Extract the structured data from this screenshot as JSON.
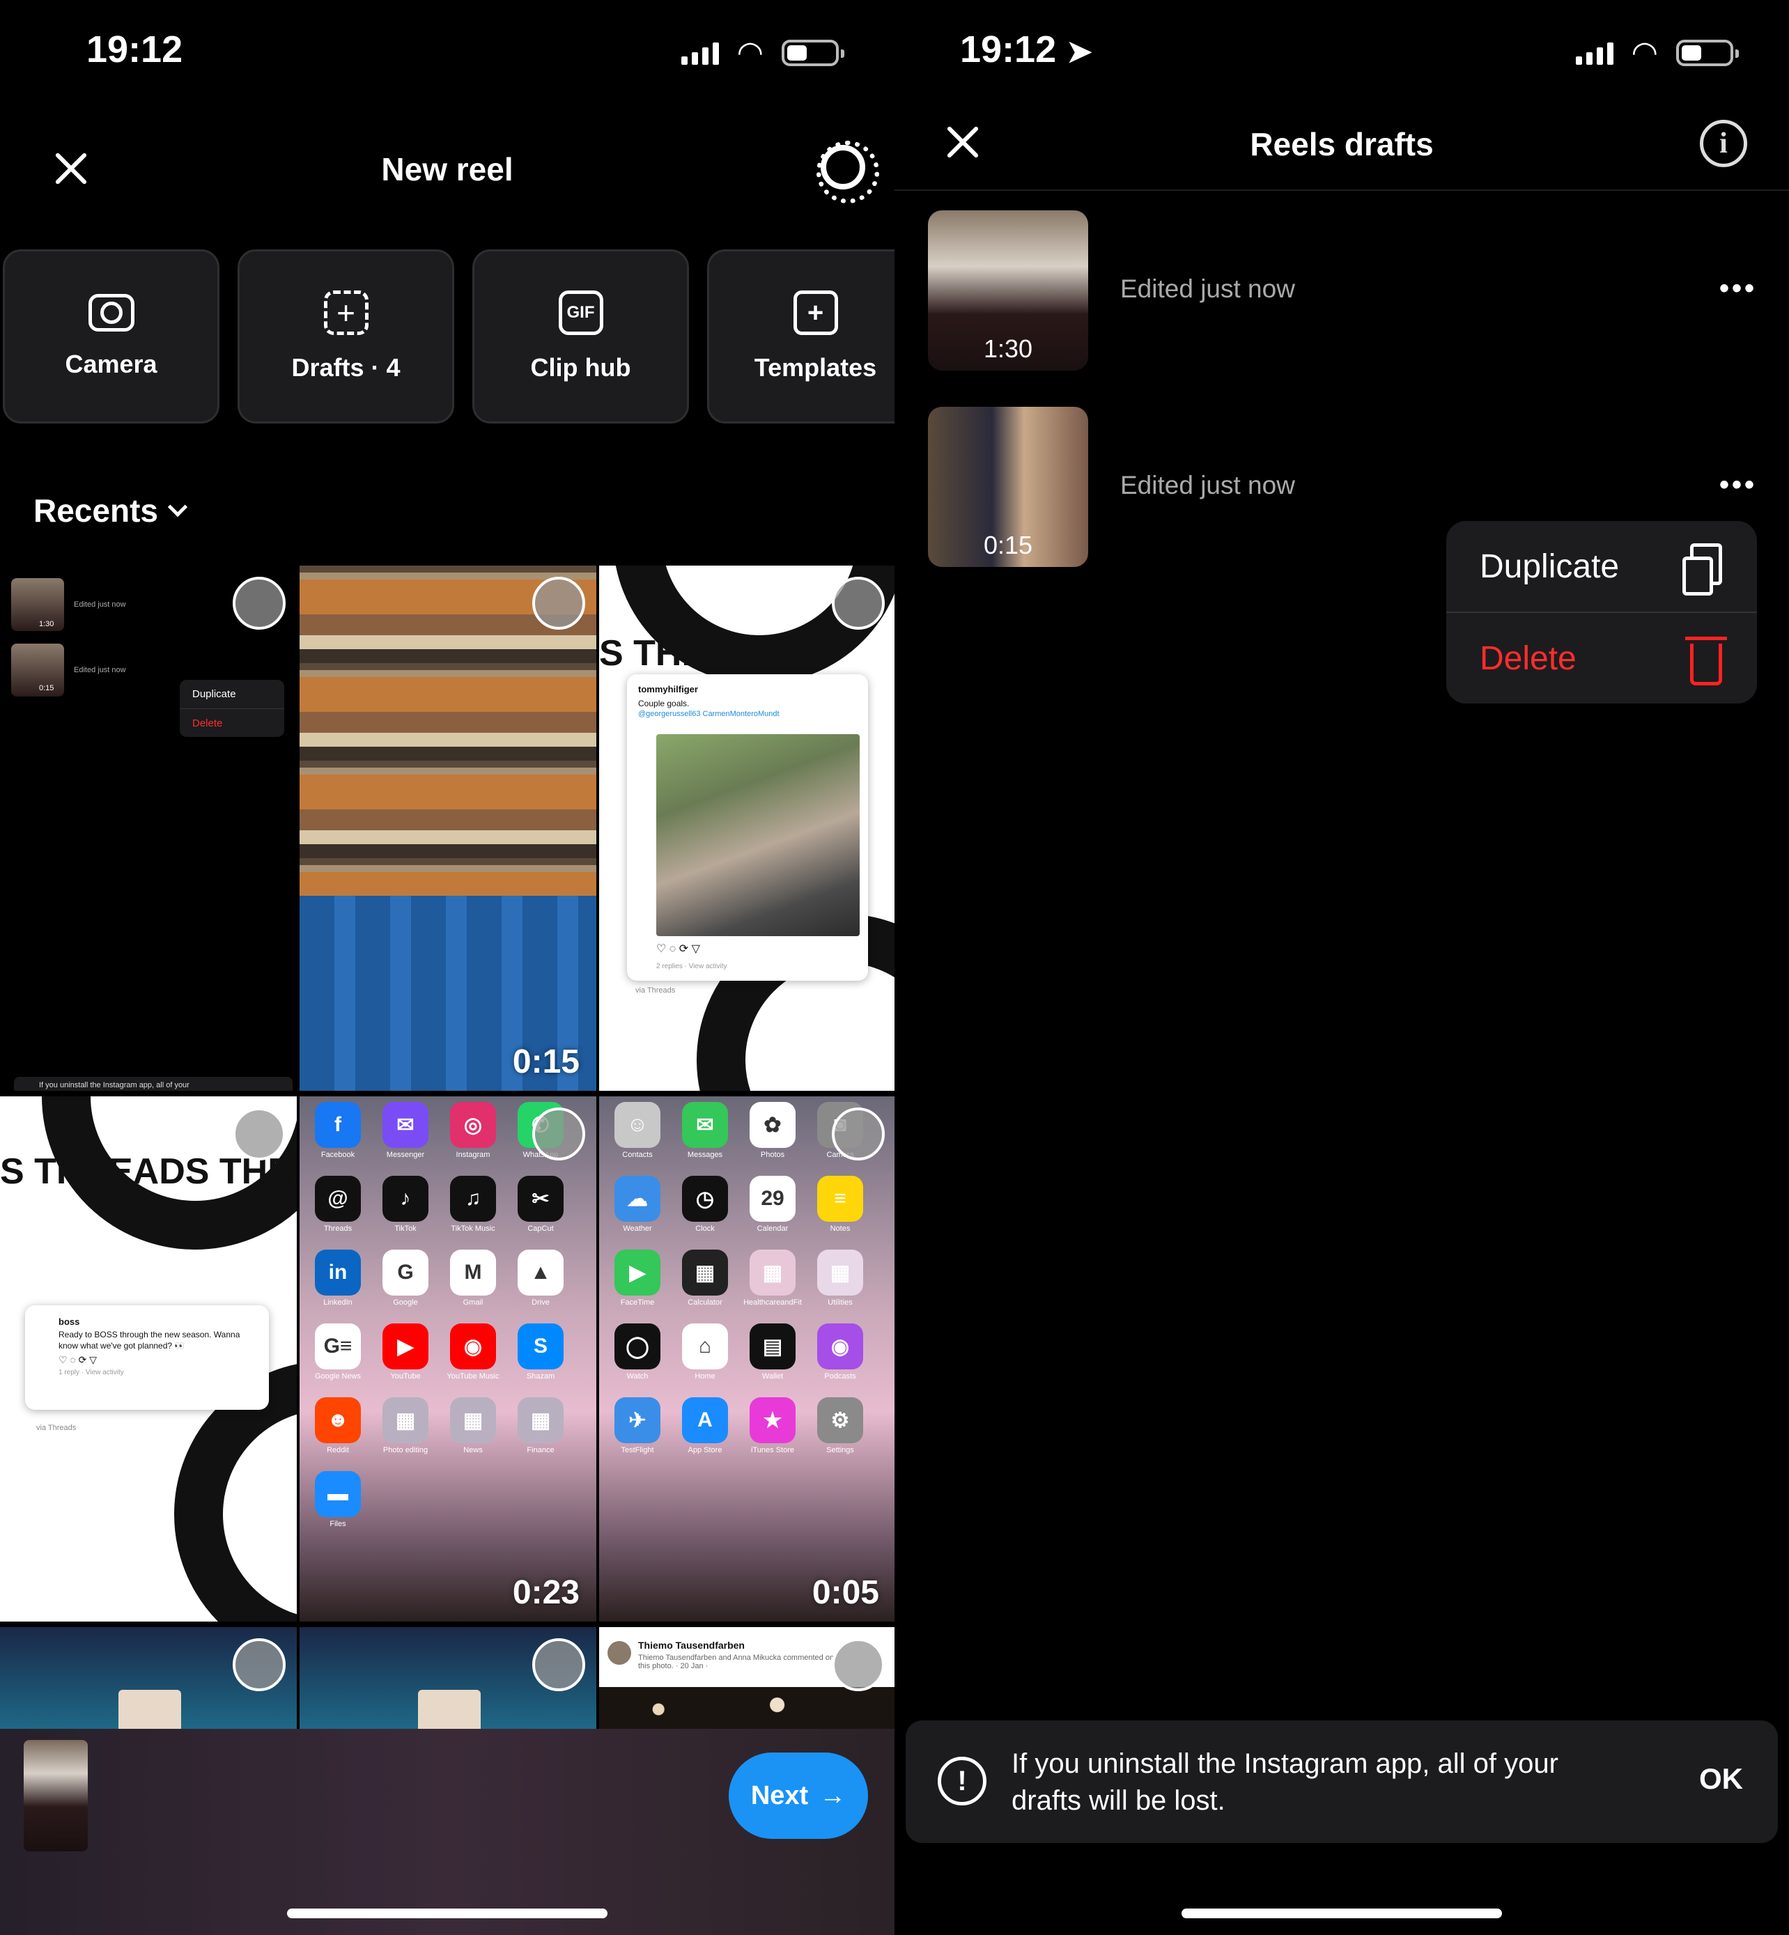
{
  "left": {
    "status": {
      "time": "19:12"
    },
    "header": {
      "title": "New reel"
    },
    "tiles": [
      {
        "label": "Camera",
        "icon": "camera-icon"
      },
      {
        "label": "Drafts · 4",
        "icon": "add-dashed-icon"
      },
      {
        "label": "Clip hub",
        "icon": "gif-icon"
      },
      {
        "label": "Templates",
        "icon": "template-add-icon"
      }
    ],
    "recents": {
      "label": "Recents"
    },
    "gallery": [
      {
        "kind": "drafts-screenshot",
        "rows": [
          {
            "duration": "1:30",
            "text": "Edited just now"
          },
          {
            "duration": "0:15",
            "text": "Edited just now"
          }
        ],
        "menu": [
          "Duplicate",
          "Delete"
        ],
        "toast_fragment": "If you uninstall the Instagram app, all of your"
      },
      {
        "kind": "video",
        "duration": "0:15"
      },
      {
        "kind": "threads-post",
        "band_text": "S THREADS",
        "handle": "tommyhilfiger",
        "body": "Couple goals.",
        "link": "@georgerussell63 CarmenMonteroMundt",
        "meta": "2 replies · View activity",
        "via": "via Threads"
      },
      {
        "kind": "threads-post",
        "band_text": "S THREADS THREADS",
        "handle": "boss",
        "body": "Ready to BOSS through the new season. Wanna know what we've got planned? 👀",
        "meta": "1 reply · View activity",
        "via": "via Threads"
      },
      {
        "kind": "homescreen",
        "duration": "0:23",
        "apps": [
          {
            "label": "Facebook",
            "glyph": "f",
            "color": "#1877f2"
          },
          {
            "label": "Messenger",
            "glyph": "✉",
            "color": "#7a4cf5"
          },
          {
            "label": "Instagram",
            "glyph": "◎",
            "color": "#e1306c"
          },
          {
            "label": "WhatsApp",
            "glyph": "✆",
            "color": "#25d366"
          },
          {
            "label": "Threads",
            "glyph": "@",
            "color": "#111111"
          },
          {
            "label": "TikTok",
            "glyph": "♪",
            "color": "#111111"
          },
          {
            "label": "TikTok Music",
            "glyph": "♫",
            "color": "#111111"
          },
          {
            "label": "CapCut",
            "glyph": "✂",
            "color": "#111111"
          },
          {
            "label": "LinkedIn",
            "glyph": "in",
            "color": "#0a66c2"
          },
          {
            "label": "Google",
            "glyph": "G",
            "color": "#ffffff"
          },
          {
            "label": "Gmail",
            "glyph": "M",
            "color": "#ffffff"
          },
          {
            "label": "Drive",
            "glyph": "▲",
            "color": "#ffffff"
          },
          {
            "label": "Google News",
            "glyph": "G≡",
            "color": "#ffffff"
          },
          {
            "label": "YouTube",
            "glyph": "▶",
            "color": "#ff0000"
          },
          {
            "label": "YouTube Music",
            "glyph": "◉",
            "color": "#ff0000"
          },
          {
            "label": "Shazam",
            "glyph": "S",
            "color": "#0088ff"
          },
          {
            "label": "Reddit",
            "glyph": "☻",
            "color": "#ff4500"
          },
          {
            "label": "Photo editing",
            "glyph": "▦",
            "color": "#b8b0c0"
          },
          {
            "label": "News",
            "glyph": "▦",
            "color": "#b8b0c0"
          },
          {
            "label": "Finance",
            "glyph": "▦",
            "color": "#b8b0c0"
          },
          {
            "label": "Files",
            "glyph": "▬",
            "color": "#1a8cff"
          }
        ]
      },
      {
        "kind": "homescreen",
        "duration": "0:05",
        "apps": [
          {
            "label": "Contacts",
            "glyph": "☺",
            "color": "#c8c8c8"
          },
          {
            "label": "Messages",
            "glyph": "✉",
            "color": "#34c759"
          },
          {
            "label": "Photos",
            "glyph": "✿",
            "color": "#ffffff"
          },
          {
            "label": "Camera",
            "glyph": "◙",
            "color": "#8a8a8a"
          },
          {
            "label": "Weather",
            "glyph": "☁",
            "color": "#3a8ee8"
          },
          {
            "label": "Clock",
            "glyph": "◷",
            "color": "#111111"
          },
          {
            "label": "Calendar",
            "glyph": "29",
            "color": "#ffffff"
          },
          {
            "label": "Notes",
            "glyph": "≡",
            "color": "#ffd60a"
          },
          {
            "label": "FaceTime",
            "glyph": "▶",
            "color": "#34c759"
          },
          {
            "label": "Calculator",
            "glyph": "▦",
            "color": "#222222"
          },
          {
            "label": "HealthcareandFit",
            "glyph": "▦",
            "color": "#e8c8d8"
          },
          {
            "label": "Utilities",
            "glyph": "▦",
            "color": "#e8d8e8"
          },
          {
            "label": "Watch",
            "glyph": "◯",
            "color": "#111111"
          },
          {
            "label": "Home",
            "glyph": "⌂",
            "color": "#ffffff"
          },
          {
            "label": "Wallet",
            "glyph": "▤",
            "color": "#111111"
          },
          {
            "label": "Podcasts",
            "glyph": "◉",
            "color": "#a64ee8"
          },
          {
            "label": "TestFlight",
            "glyph": "✈",
            "color": "#3a8ee8"
          },
          {
            "label": "App Store",
            "glyph": "A",
            "color": "#1a8cff"
          },
          {
            "label": "iTunes Store",
            "glyph": "★",
            "color": "#e83ad8"
          },
          {
            "label": "Settings",
            "glyph": "⚙",
            "color": "#8a8a8a"
          }
        ]
      },
      {
        "kind": "video-partial"
      },
      {
        "kind": "video-partial"
      },
      {
        "kind": "facebook-post",
        "author": "Thiemo Tausendfarben",
        "caption": "Thiemo Tausendfarben and Anna Mikucka commented on this photo. · 20 Jan ·"
      }
    ],
    "footer": {
      "next_label": "Next",
      "next_arrow": "→"
    }
  },
  "right": {
    "status": {
      "time": "19:12"
    },
    "header": {
      "title": "Reels drafts",
      "info_glyph": "i"
    },
    "drafts": [
      {
        "duration": "1:30",
        "edited": "Edited just now"
      },
      {
        "duration": "0:15",
        "edited": "Edited just now"
      }
    ],
    "menu": {
      "duplicate_label": "Duplicate",
      "delete_label": "Delete",
      "delete_color": "#ff2d2d"
    },
    "toast": {
      "text": "If you uninstall the Instagram app, all of your drafts will be lost.",
      "ok_label": "OK"
    }
  },
  "colors": {
    "accent": "#1a93f5",
    "danger": "#ff2d2d",
    "surface": "#1c1c1e"
  }
}
